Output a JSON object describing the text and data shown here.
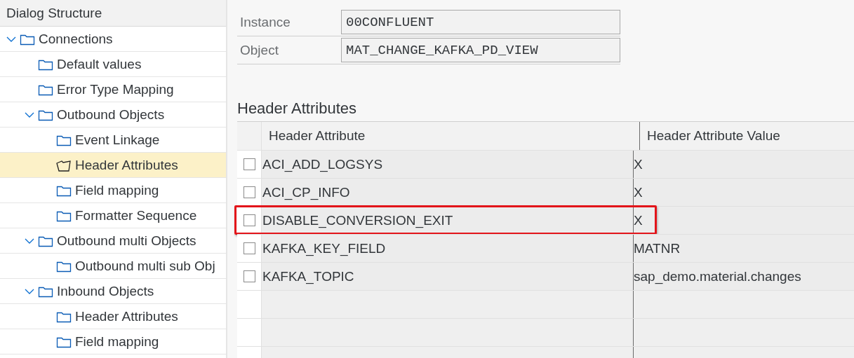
{
  "sidebar": {
    "title": "Dialog Structure",
    "tree": [
      {
        "label": "Connections",
        "expanded": true,
        "selected": false,
        "children": [
          {
            "label": "Default values",
            "selected": false
          },
          {
            "label": "Error Type Mapping",
            "selected": false
          },
          {
            "label": "Outbound  Objects",
            "expanded": true,
            "selected": false,
            "children": [
              {
                "label": "Event Linkage",
                "selected": false
              },
              {
                "label": "Header Attributes",
                "selected": true
              },
              {
                "label": "Field mapping",
                "selected": false
              },
              {
                "label": "Formatter Sequence",
                "selected": false
              }
            ]
          },
          {
            "label": "Outbound multi Objects",
            "expanded": true,
            "selected": false,
            "children": [
              {
                "label": "Outbound multi sub Obj",
                "selected": false
              }
            ]
          },
          {
            "label": "Inbound Objects",
            "expanded": true,
            "selected": false,
            "children": [
              {
                "label": "Header Attributes",
                "selected": false
              },
              {
                "label": "Field mapping",
                "selected": false
              }
            ]
          }
        ]
      }
    ]
  },
  "fields": [
    {
      "label": "Instance",
      "value": "00CONFLUENT"
    },
    {
      "label": "Object",
      "value": "MAT_CHANGE_KAFKA_PD_VIEW"
    }
  ],
  "section_title": "Header Attributes",
  "table": {
    "columns": [
      "Header Attribute",
      "Header Attribute Value"
    ],
    "rows": [
      {
        "attribute": "ACI_ADD_LOGSYS",
        "value": "X",
        "checked": false,
        "highlighted": false
      },
      {
        "attribute": "ACI_CP_INFO",
        "value": "X",
        "checked": false,
        "highlighted": false
      },
      {
        "attribute": "DISABLE_CONVERSION_EXIT",
        "value": "X",
        "checked": false,
        "highlighted": true
      },
      {
        "attribute": "KAFKA_KEY_FIELD",
        "value": "MATNR",
        "checked": false,
        "highlighted": false
      },
      {
        "attribute": "KAFKA_TOPIC",
        "value": "sap_demo.material.changes",
        "checked": false,
        "highlighted": false
      }
    ]
  }
}
